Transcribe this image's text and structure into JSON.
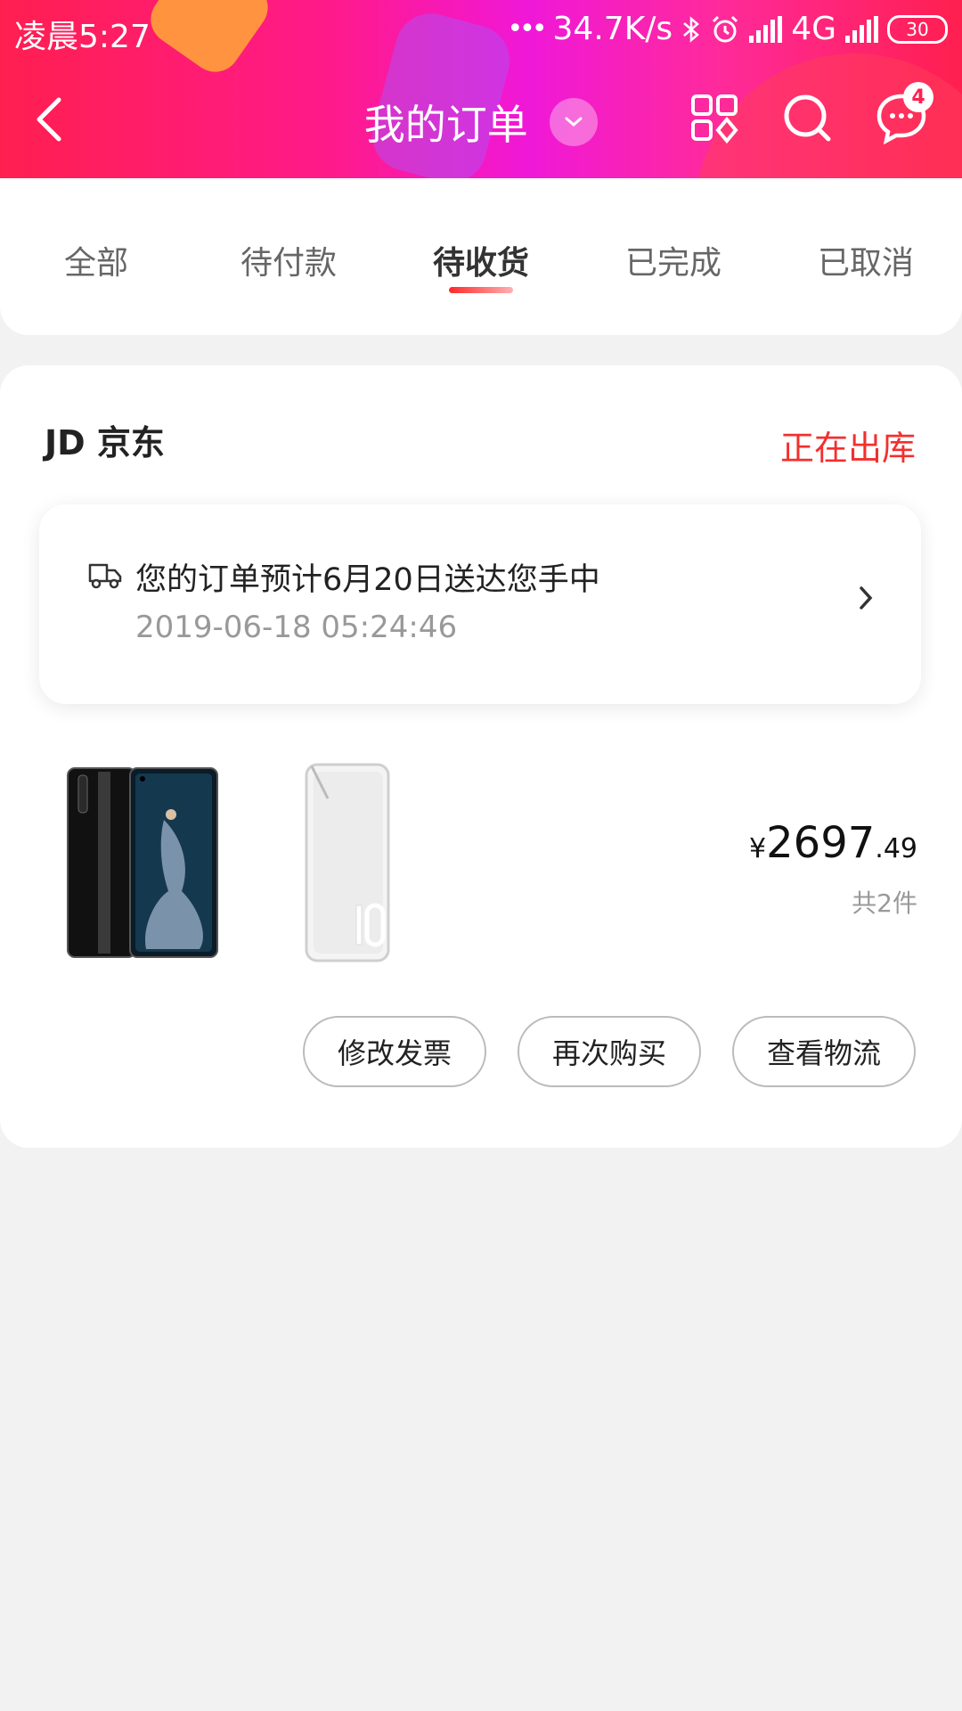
{
  "status_bar": {
    "time": "凌晨5:27",
    "net_speed": "34.7K/s",
    "network": "4G",
    "battery": "30"
  },
  "nav": {
    "title": "我的订单",
    "message_badge": "4"
  },
  "tabs": [
    {
      "label": "全部"
    },
    {
      "label": "待付款"
    },
    {
      "label": "待收货",
      "active": true
    },
    {
      "label": "已完成"
    },
    {
      "label": "已取消"
    }
  ],
  "order": {
    "shop_name": "JD 京东",
    "status": "正在出库",
    "delivery": {
      "message": "您的订单预计6月20日送达您手中",
      "time": "2019-06-18 05:24:46"
    },
    "price": {
      "currency": "¥",
      "integer": "2697",
      "decimal": ".49"
    },
    "count": "共2件",
    "buttons": {
      "modify_invoice": "修改发票",
      "buy_again": "再次购买",
      "view_logistics": "查看物流"
    }
  },
  "colors": {
    "accent": "#f2302e",
    "header_start": "#ff1f4f",
    "header_mid": "#f018d8"
  },
  "icons": [
    "back-icon",
    "chevron-down-icon",
    "category-grid-icon",
    "search-icon",
    "message-icon",
    "truck-icon",
    "chevron-right-icon",
    "bluetooth-icon",
    "alarm-icon"
  ]
}
